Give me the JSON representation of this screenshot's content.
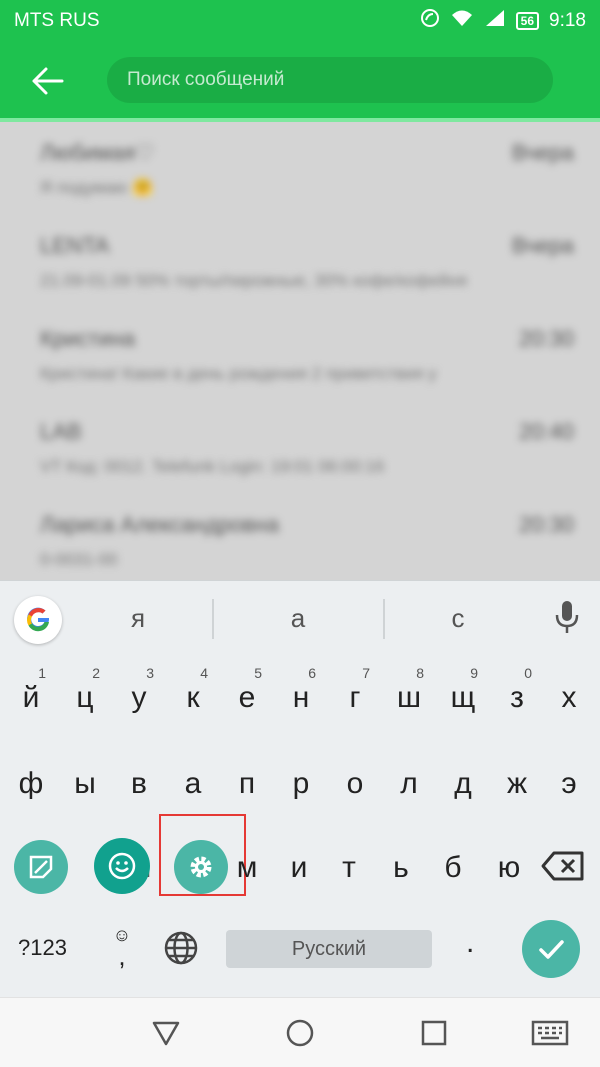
{
  "status": {
    "carrier": "MTS RUS",
    "battery": "56",
    "time": "9:18"
  },
  "search": {
    "placeholder": "Поиск сообщений"
  },
  "messages": [
    {
      "sender": "Любимая♡",
      "time": "Вчера",
      "preview": "Я подумаю 🤗"
    },
    {
      "sender": "LENTA",
      "time": "Вчера",
      "preview": "21.09-01.09 50% торты/пирожные, 30% кофе/кофейня"
    },
    {
      "sender": "Кристина",
      "time": "20:30",
      "preview": "Кристина! Какие в день рождения 2 приветствия у"
    },
    {
      "sender": "LAB",
      "time": "20:40",
      "preview": "VT Код: 0012. Telefunk Login: 19:01 06:00:16"
    },
    {
      "sender": "Лариса Александровна",
      "time": "20:30",
      "preview": "0-0031-00"
    }
  ],
  "keyboard": {
    "suggestions": [
      "я",
      "а",
      "с"
    ],
    "row1": [
      {
        "key": "й",
        "num": "1"
      },
      {
        "key": "ц",
        "num": "2"
      },
      {
        "key": "у",
        "num": "3"
      },
      {
        "key": "к",
        "num": "4"
      },
      {
        "key": "е",
        "num": "5"
      },
      {
        "key": "н",
        "num": "6"
      },
      {
        "key": "г",
        "num": "7"
      },
      {
        "key": "ш",
        "num": "8"
      },
      {
        "key": "щ",
        "num": "9"
      },
      {
        "key": "з",
        "num": "0"
      },
      {
        "key": "х",
        "num": ""
      }
    ],
    "row2": [
      "ф",
      "ы",
      "в",
      "а",
      "п",
      "р",
      "о",
      "л",
      "д",
      "ж",
      "э"
    ],
    "row3": [
      "м",
      "и",
      "т",
      "ь",
      "б",
      "ю"
    ],
    "symbols_label": "?123",
    "comma": ",",
    "space_label": "Русский",
    "period": "."
  },
  "colors": {
    "accent_green": "#1ec24f",
    "keyboard_teal": "#4bb6a6",
    "highlight_red": "#e53935"
  }
}
